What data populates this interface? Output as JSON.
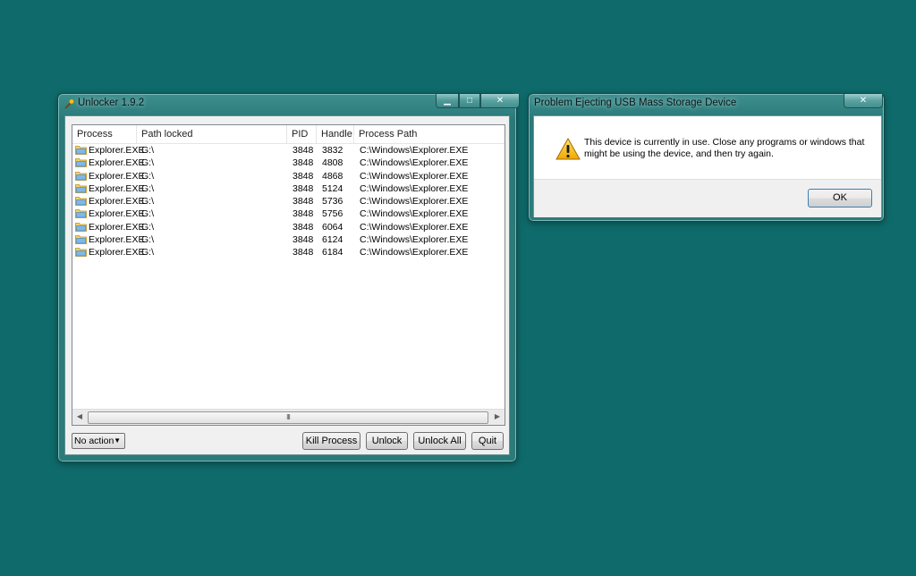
{
  "unlocker": {
    "title": "Unlocker 1.9.2",
    "columns": [
      "Process",
      "Path locked",
      "PID",
      "Handle",
      "Process Path"
    ],
    "rows": [
      {
        "process": "Explorer.EXE",
        "path": "G:\\",
        "pid": "3848",
        "handle": "3832",
        "process_path": "C:\\Windows\\Explorer.EXE"
      },
      {
        "process": "Explorer.EXE",
        "path": "G:\\",
        "pid": "3848",
        "handle": "4808",
        "process_path": "C:\\Windows\\Explorer.EXE"
      },
      {
        "process": "Explorer.EXE",
        "path": "G:\\",
        "pid": "3848",
        "handle": "4868",
        "process_path": "C:\\Windows\\Explorer.EXE"
      },
      {
        "process": "Explorer.EXE",
        "path": "G:\\",
        "pid": "3848",
        "handle": "5124",
        "process_path": "C:\\Windows\\Explorer.EXE"
      },
      {
        "process": "Explorer.EXE",
        "path": "G:\\",
        "pid": "3848",
        "handle": "5736",
        "process_path": "C:\\Windows\\Explorer.EXE"
      },
      {
        "process": "Explorer.EXE",
        "path": "G:\\",
        "pid": "3848",
        "handle": "5756",
        "process_path": "C:\\Windows\\Explorer.EXE"
      },
      {
        "process": "Explorer.EXE",
        "path": "G:\\",
        "pid": "3848",
        "handle": "6064",
        "process_path": "C:\\Windows\\Explorer.EXE"
      },
      {
        "process": "Explorer.EXE",
        "path": "G:\\",
        "pid": "3848",
        "handle": "6124",
        "process_path": "C:\\Windows\\Explorer.EXE"
      },
      {
        "process": "Explorer.EXE",
        "path": "G:\\",
        "pid": "3848",
        "handle": "6184",
        "process_path": "C:\\Windows\\Explorer.EXE"
      }
    ],
    "action_select": "No action",
    "buttons": {
      "kill_process": "Kill Process",
      "unlock": "Unlock",
      "unlock_all": "Unlock All",
      "quit": "Quit"
    },
    "row_icon": "folder-icon",
    "scroll_thumb_grip": "III"
  },
  "eject_dialog": {
    "title": "Problem Ejecting USB Mass Storage Device",
    "message": "This device is currently in use. Close any programs or windows that might be using the device, and then try again.",
    "ok_label": "OK",
    "icon": "warning-icon"
  },
  "caption": {
    "minimize": "▁",
    "maximize": "□",
    "close": "✕"
  },
  "colors": {
    "desktop": "#0f6b6b",
    "window_frame": "#2c7b7b"
  }
}
